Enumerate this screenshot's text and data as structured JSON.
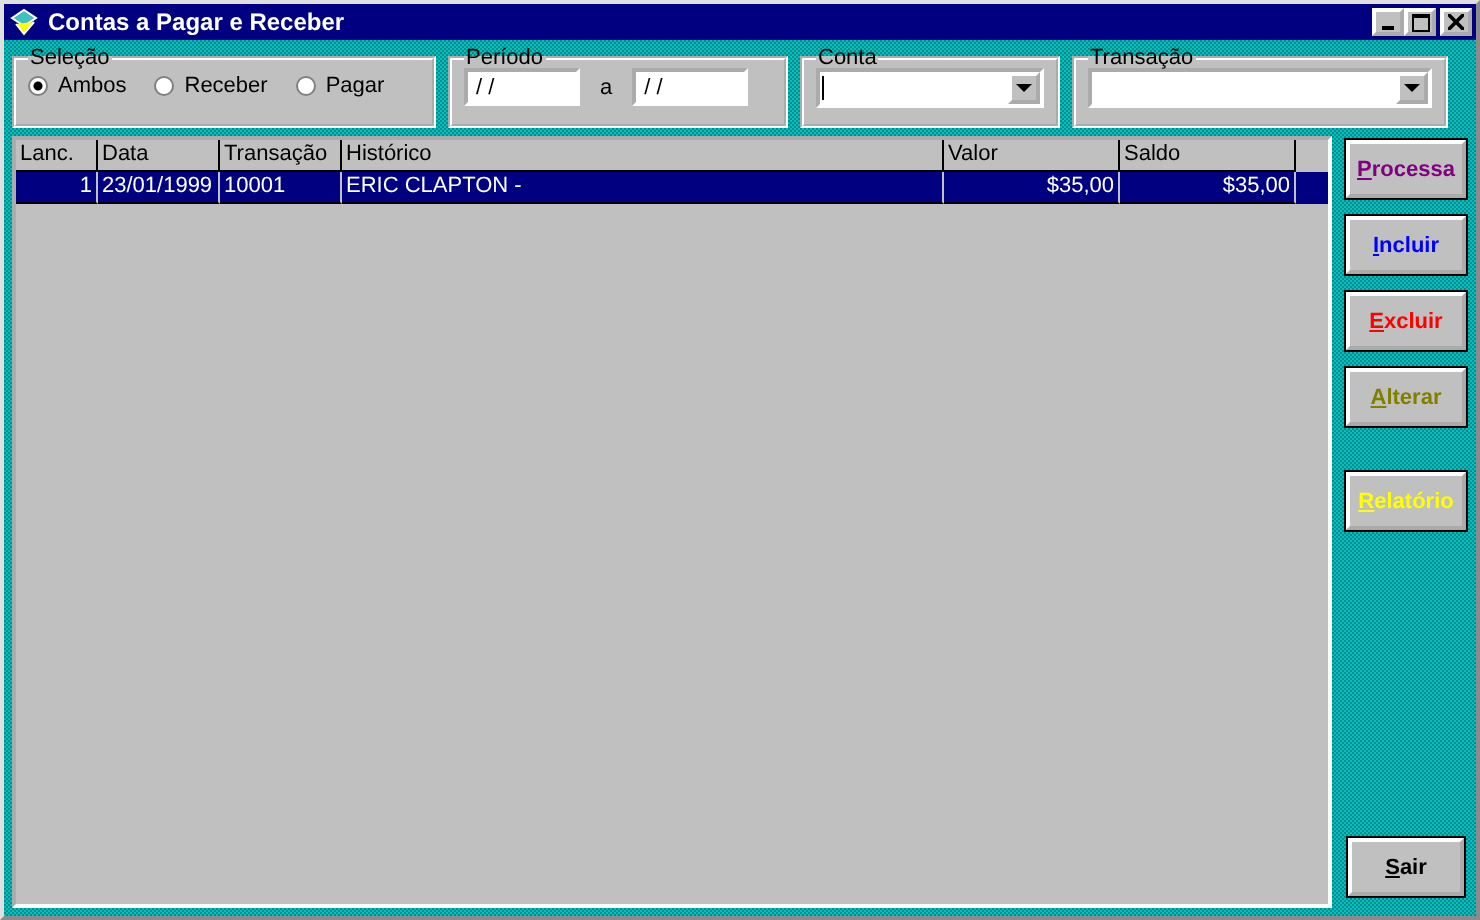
{
  "window": {
    "title": "Contas a Pagar e Receber"
  },
  "selecao": {
    "label": "Seleção",
    "options": [
      {
        "label": "Ambos",
        "selected": true
      },
      {
        "label": "Receber",
        "selected": false
      },
      {
        "label": "Pagar",
        "selected": false
      }
    ]
  },
  "periodo": {
    "label": "Período",
    "from": "/ /",
    "separator": "a",
    "to": "/ /"
  },
  "conta": {
    "label": "Conta"
  },
  "transacao": {
    "label": "Transação"
  },
  "table": {
    "columns": [
      "Lanc.",
      "Data",
      "Transação",
      "Histórico",
      "Valor",
      "Saldo"
    ],
    "rows": [
      {
        "selected": true,
        "cells": [
          "1",
          "23/01/1999",
          "10001",
          "ERIC CLAPTON -",
          "$35,00",
          "$35,00"
        ]
      }
    ]
  },
  "buttons": [
    {
      "label": "Processa",
      "color": "#800080"
    },
    {
      "label": "Incluir",
      "color": "#0000ff"
    },
    {
      "label": "Excluir",
      "color": "#ff0000"
    },
    {
      "label": "Alterar",
      "color": "#808000"
    },
    {
      "label": "Relatório",
      "color": "#ffff00"
    },
    {
      "label": "Sair",
      "color": "#000000"
    }
  ]
}
